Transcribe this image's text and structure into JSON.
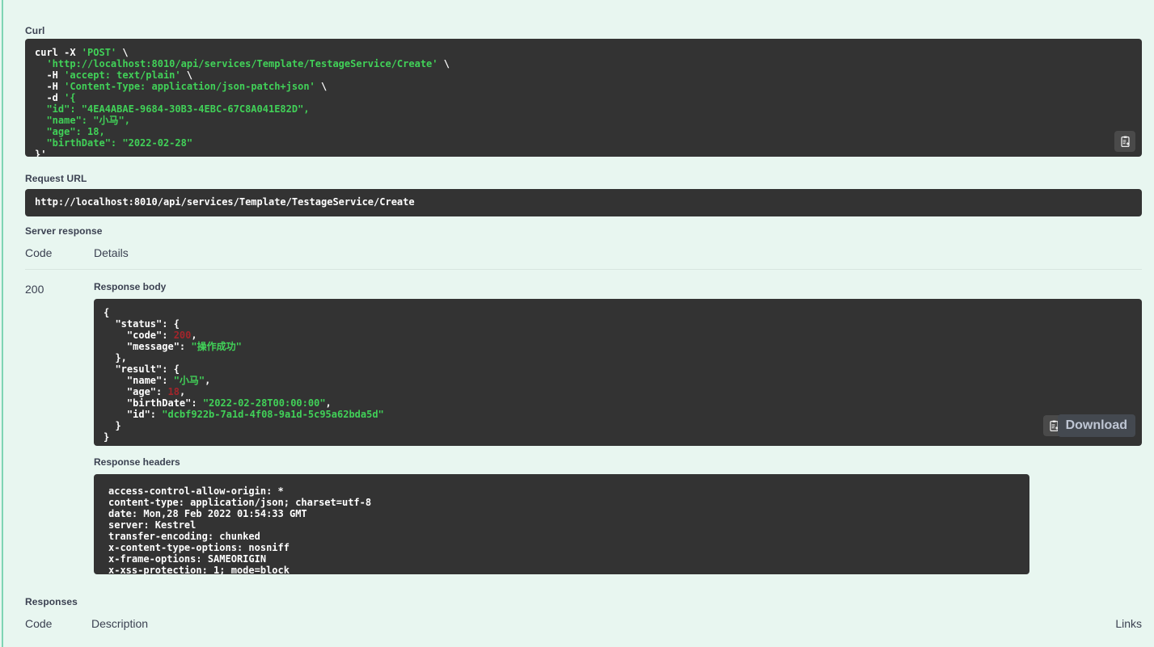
{
  "colors": {
    "page_background": "#e8f6f0",
    "code_background": "#333333",
    "string_green": "#41d158",
    "number_red": "#a3252b",
    "text_dark": "#3b4151",
    "button_gray": "#444950"
  },
  "curl": {
    "label": "Curl",
    "copy_icon": "clipboard-copy-icon",
    "lines": [
      [
        {
          "t": "curl -X ",
          "c": "plain"
        },
        {
          "t": "'POST'",
          "c": "str"
        },
        {
          "t": " \\",
          "c": "plain"
        }
      ],
      [
        {
          "t": "  ",
          "c": "plain"
        },
        {
          "t": "'http://localhost:8010/api/services/Template/TestageService/Create'",
          "c": "str"
        },
        {
          "t": " \\",
          "c": "plain"
        }
      ],
      [
        {
          "t": "  -H ",
          "c": "plain"
        },
        {
          "t": "'accept: text/plain'",
          "c": "str"
        },
        {
          "t": " \\",
          "c": "plain"
        }
      ],
      [
        {
          "t": "  -H ",
          "c": "plain"
        },
        {
          "t": "'Content-Type: application/json-patch+json'",
          "c": "str"
        },
        {
          "t": " \\",
          "c": "plain"
        }
      ],
      [
        {
          "t": "  -d ",
          "c": "plain"
        },
        {
          "t": "'{",
          "c": "str"
        }
      ],
      [
        {
          "t": "  \"id\": \"4EA4ABAE-9684-30B3-4EBC-67C8A041E82D\",",
          "c": "str"
        }
      ],
      [
        {
          "t": "  \"name\": \"小马\",",
          "c": "str"
        }
      ],
      [
        {
          "t": "  \"age\": 18,",
          "c": "str"
        }
      ],
      [
        {
          "t": "  \"birthDate\": \"2022-02-28\"",
          "c": "str"
        }
      ],
      [
        {
          "t": "}'",
          "c": "plain"
        }
      ]
    ]
  },
  "request_url": {
    "label": "Request URL",
    "url": "http://localhost:8010/api/services/Template/TestageService/Create"
  },
  "server_response": {
    "label": "Server response",
    "headers": {
      "code": "Code",
      "details": "Details"
    },
    "row": {
      "code": "200",
      "response_body_label": "Response body",
      "response_headers_label": "Response headers",
      "copy_icon": "clipboard-copy-icon",
      "download_label": "Download",
      "body_lines": [
        [
          {
            "t": "{",
            "c": "key"
          }
        ],
        [
          {
            "t": "  \"status\"",
            "c": "key"
          },
          {
            "t": ": {",
            "c": "key"
          }
        ],
        [
          {
            "t": "    \"code\"",
            "c": "key"
          },
          {
            "t": ": ",
            "c": "key"
          },
          {
            "t": "200",
            "c": "num"
          },
          {
            "t": ",",
            "c": "key"
          }
        ],
        [
          {
            "t": "    \"message\"",
            "c": "key"
          },
          {
            "t": ": ",
            "c": "key"
          },
          {
            "t": "\"操作成功\"",
            "c": "str"
          }
        ],
        [
          {
            "t": "  },",
            "c": "key"
          }
        ],
        [
          {
            "t": "  \"result\"",
            "c": "key"
          },
          {
            "t": ": {",
            "c": "key"
          }
        ],
        [
          {
            "t": "    \"name\"",
            "c": "key"
          },
          {
            "t": ": ",
            "c": "key"
          },
          {
            "t": "\"小马\"",
            "c": "str"
          },
          {
            "t": ",",
            "c": "key"
          }
        ],
        [
          {
            "t": "    \"age\"",
            "c": "key"
          },
          {
            "t": ": ",
            "c": "key"
          },
          {
            "t": "18",
            "c": "num"
          },
          {
            "t": ",",
            "c": "key"
          }
        ],
        [
          {
            "t": "    \"birthDate\"",
            "c": "key"
          },
          {
            "t": ": ",
            "c": "key"
          },
          {
            "t": "\"2022-02-28T00:00:00\"",
            "c": "str"
          },
          {
            "t": ",",
            "c": "key"
          }
        ],
        [
          {
            "t": "    \"id\"",
            "c": "key"
          },
          {
            "t": ": ",
            "c": "key"
          },
          {
            "t": "\"dcbf922b-7a1d-4f08-9a1d-5c95a62bda5d\"",
            "c": "str"
          }
        ],
        [
          {
            "t": "  }",
            "c": "key"
          }
        ],
        [
          {
            "t": "}",
            "c": "key"
          }
        ]
      ],
      "header_lines": [
        "access-control-allow-origin: *",
        "content-type: application/json; charset=utf-8",
        "date: Mon,28 Feb 2022 01:54:33 GMT",
        "server: Kestrel",
        "transfer-encoding: chunked",
        "x-content-type-options: nosniff",
        "x-frame-options: SAMEORIGIN",
        "x-xss-protection: 1; mode=block"
      ]
    }
  },
  "responses": {
    "label": "Responses",
    "headers": {
      "code": "Code",
      "description": "Description",
      "links": "Links"
    }
  }
}
